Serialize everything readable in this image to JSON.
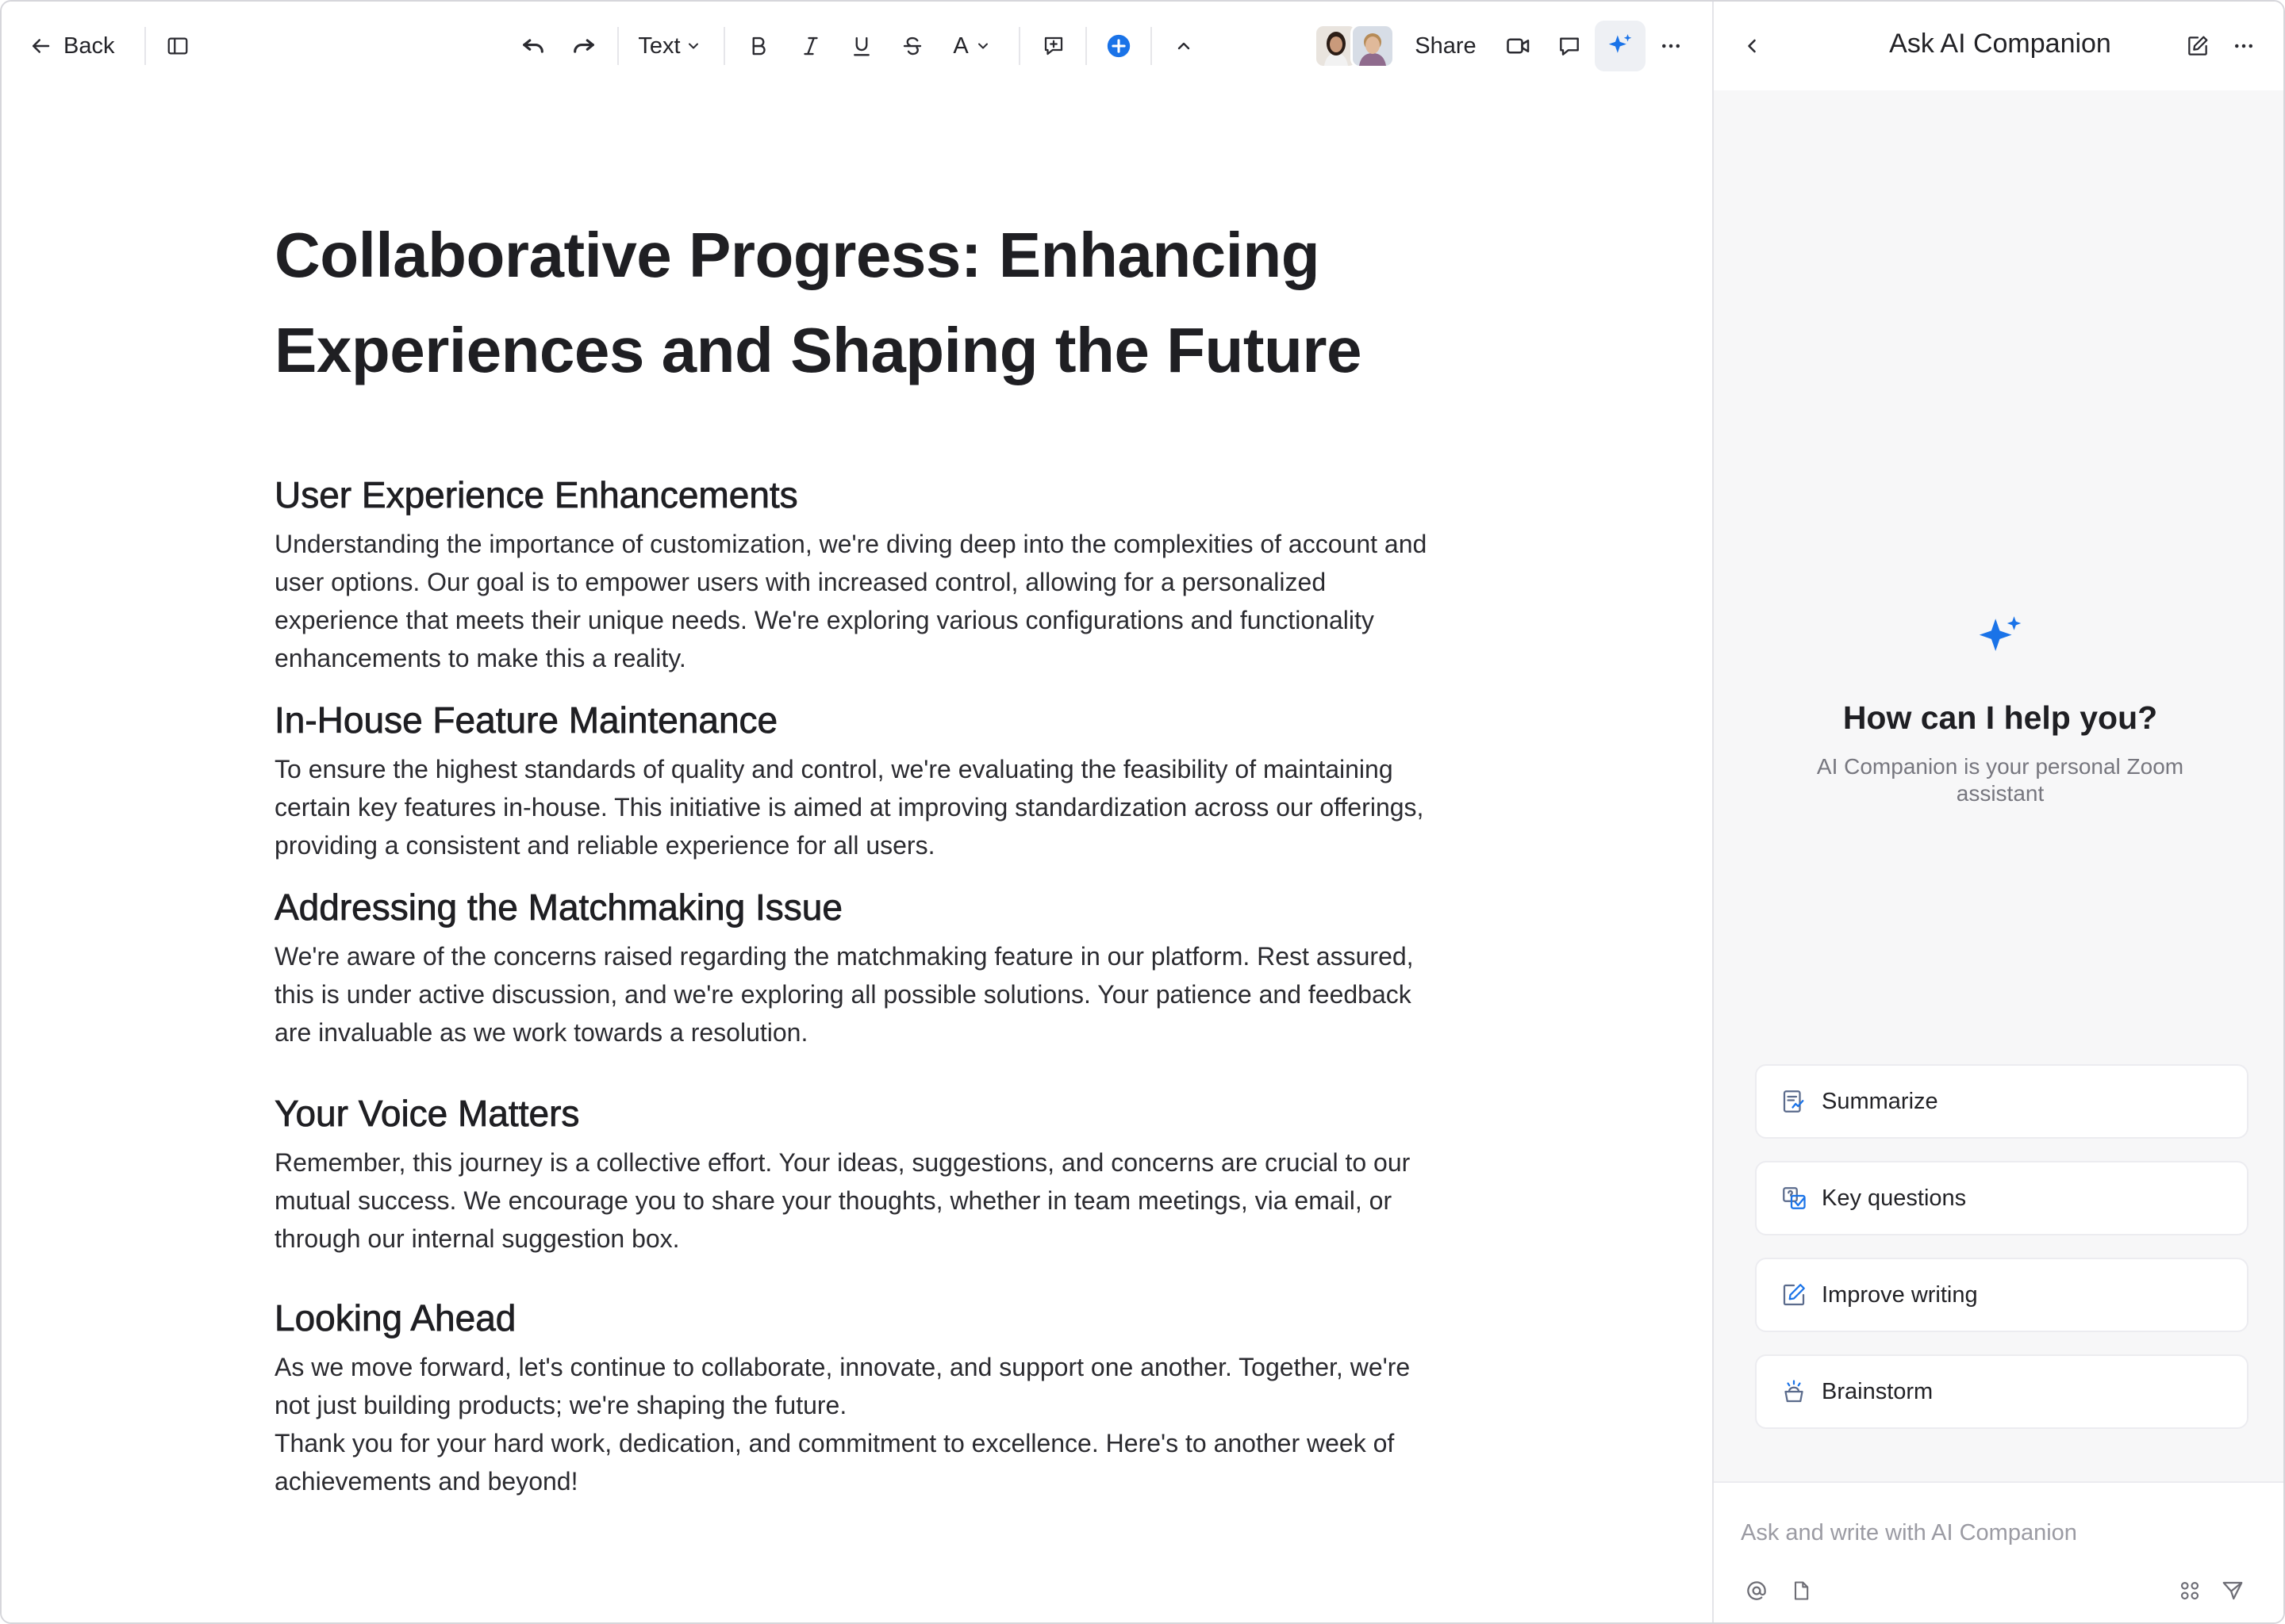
{
  "toolbar": {
    "back_label": "Back",
    "text_style_label": "Text",
    "font_color_label": "A",
    "share_label": "Share",
    "accent_color": "#1a73e8",
    "icons": [
      "arrow-left-icon",
      "sidebar-toggle-icon",
      "undo-icon",
      "redo-icon",
      "chevron-down-icon",
      "bold-icon",
      "italic-icon",
      "underline-icon",
      "strikethrough-icon",
      "comment-add-icon",
      "plus-circle-icon",
      "chevron-up-icon",
      "video-camera-icon",
      "chat-bubble-icon",
      "ai-sparkle-icon",
      "more-horizontal-icon"
    ]
  },
  "collaborators": [
    {
      "name": "collaborator-1",
      "skin": "#c99a7b",
      "hair": "#2b1d16",
      "bg": "#e9e4de"
    },
    {
      "name": "collaborator-2",
      "skin": "#e0b99a",
      "hair": "#b68b57",
      "bg": "#d7dde6"
    }
  ],
  "document": {
    "title": "Collaborative Progress: Enhancing Experiences and Shaping the Future",
    "sections": [
      {
        "heading": "User Experience Enhancements",
        "body": "Understanding the importance of customization, we're diving deep into the complexities of account and user options. Our goal is to empower users with increased control, allowing for a personalized experience that meets their unique needs. We're exploring various configurations and functionality enhancements to make this a reality."
      },
      {
        "heading": "In-House Feature Maintenance",
        "body": "To ensure the highest standards of quality and control, we're evaluating the feasibility of maintaining certain key features in-house. This initiative is aimed at improving standardization across our offerings, providing a consistent and reliable experience for all users."
      },
      {
        "heading": "Addressing the Matchmaking Issue",
        "body": "We're aware of the concerns raised regarding the matchmaking feature in our platform. Rest assured, this is under active discussion, and we're exploring all possible solutions. Your patience and feedback are invaluable as we work towards a resolution."
      },
      {
        "heading": "Your Voice Matters",
        "body": "Remember, this journey is a collective effort. Your ideas, suggestions, and concerns are crucial to our mutual success. We encourage you to share your thoughts, whether in team meetings, via email, or through our internal suggestion box."
      },
      {
        "heading": "Looking Ahead",
        "body": "As we move forward, let's continue to collaborate, innovate, and support one another. Together, we're not just building products; we're shaping the future.",
        "body2": "Thank you for your hard work, dedication, and commitment to excellence. Here's to another week of achievements and beyond!"
      }
    ]
  },
  "ai_panel": {
    "title": "Ask AI Companion",
    "hero_title": "How can I help you?",
    "hero_subtitle": "AI Companion is your personal Zoom assistant",
    "chips": [
      {
        "label": "Summarize",
        "icon": "summarize-icon"
      },
      {
        "label": "Key questions",
        "icon": "key-questions-icon"
      },
      {
        "label": "Improve writing",
        "icon": "improve-writing-icon"
      },
      {
        "label": "Brainstorm",
        "icon": "brainstorm-icon"
      }
    ],
    "composer_placeholder": "Ask and write with AI Companion",
    "icons": [
      "chevron-left-icon",
      "compose-icon",
      "more-horizontal-icon",
      "at-mention-icon",
      "file-icon",
      "apps-icon",
      "send-icon"
    ]
  }
}
